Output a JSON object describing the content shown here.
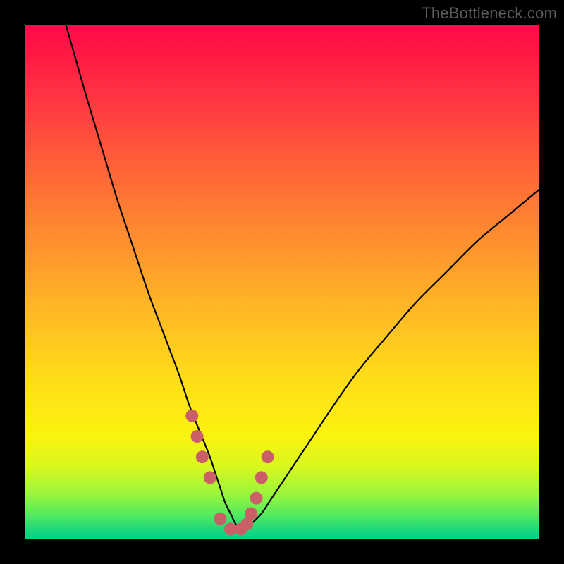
{
  "watermark": "TheBottleneck.com",
  "colors": {
    "frame": "#000000",
    "gradient_top": "#ff0a4a",
    "gradient_mid": "#ffe018",
    "gradient_bottom": "#00d08a",
    "curve": "#000000",
    "markers": "#cb5f68"
  },
  "chart_data": {
    "type": "line",
    "title": "",
    "xlabel": "",
    "ylabel": "",
    "xlim": [
      0,
      100
    ],
    "ylim": [
      0,
      100
    ],
    "series": [
      {
        "name": "bottleneck-curve",
        "x": [
          8,
          10,
          12,
          15,
          18,
          21,
          24,
          27,
          30,
          32,
          34,
          36,
          37,
          38,
          39,
          40,
          41,
          42,
          43,
          44,
          46,
          48,
          52,
          56,
          60,
          65,
          70,
          76,
          82,
          88,
          94,
          100
        ],
        "y": [
          100,
          93,
          86,
          76,
          66,
          57,
          48,
          40,
          32,
          26,
          21,
          16,
          13,
          10,
          7,
          5,
          3,
          2,
          2,
          3,
          5,
          8,
          14,
          20,
          26,
          33,
          39,
          46,
          52,
          58,
          63,
          68
        ]
      }
    ],
    "markers": {
      "name": "highlight-points",
      "x": [
        32.5,
        33.5,
        34.5,
        36,
        38,
        40,
        42,
        43.2,
        44,
        45,
        46,
        47.2
      ],
      "y": [
        24,
        20,
        16,
        12,
        4,
        2,
        2,
        3,
        5,
        8,
        12,
        16
      ]
    }
  }
}
